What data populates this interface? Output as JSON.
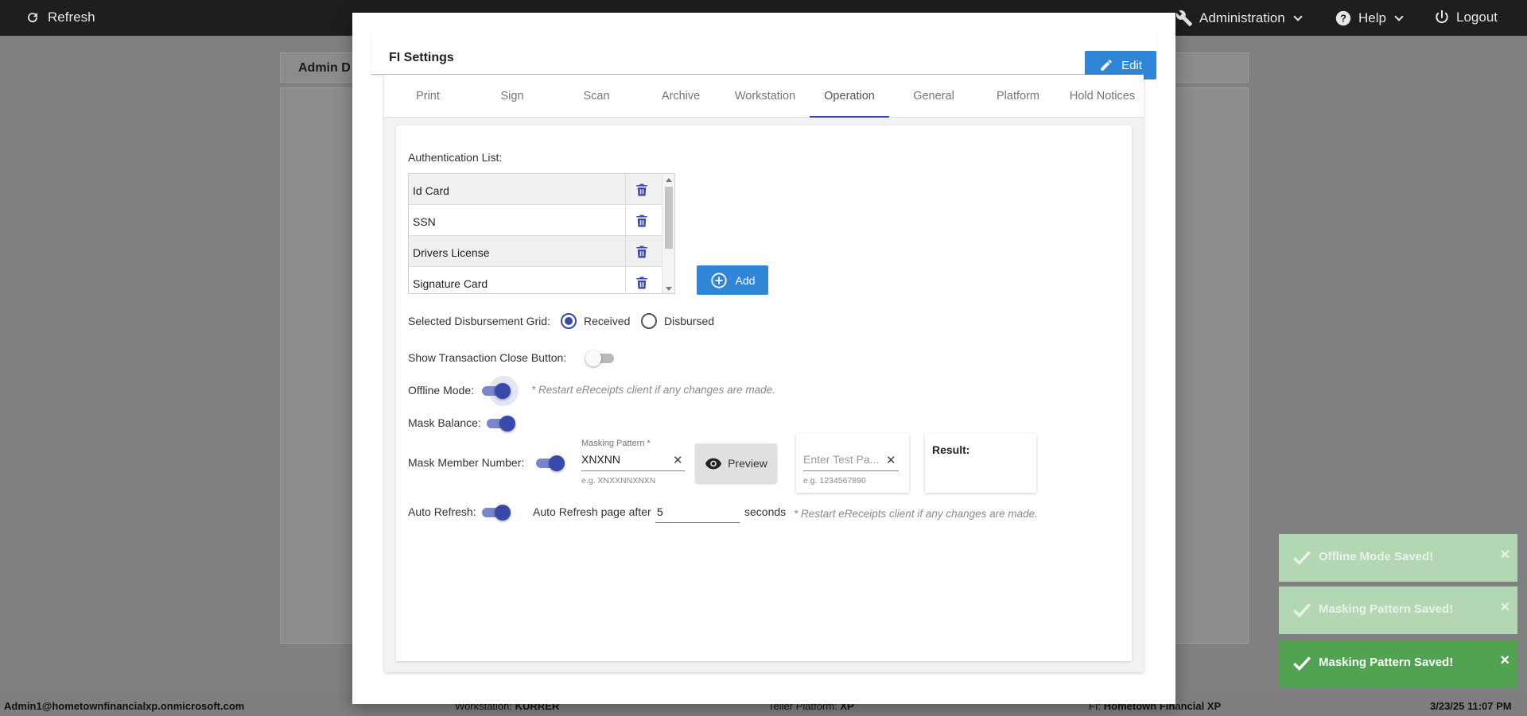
{
  "topbar": {
    "refresh_label": "Refresh",
    "administration_label": "Administration",
    "help_label": "Help",
    "logout_label": "Logout"
  },
  "background": {
    "tab_label": "Admin D"
  },
  "modal": {
    "title": "FI Settings",
    "edit_label": "Edit",
    "tabs": [
      {
        "label": "Print"
      },
      {
        "label": "Sign"
      },
      {
        "label": "Scan"
      },
      {
        "label": "Archive"
      },
      {
        "label": "Workstation"
      },
      {
        "label": "Operation"
      },
      {
        "label": "General"
      },
      {
        "label": "Platform"
      },
      {
        "label": "Hold Notices"
      }
    ],
    "active_tab": "Operation"
  },
  "operation": {
    "auth_list_label": "Authentication List:",
    "auth_items": [
      {
        "name": "Id Card"
      },
      {
        "name": "SSN"
      },
      {
        "name": "Drivers License"
      },
      {
        "name": "Signature Card"
      }
    ],
    "add_label": "Add",
    "disbursement_label": "Selected Disbursement Grid:",
    "disbursement_options": [
      {
        "label": "Received",
        "selected": true
      },
      {
        "label": "Disbursed",
        "selected": false
      }
    ],
    "show_close_label": "Show Transaction Close Button:",
    "show_close_on": false,
    "offline_label": "Offline Mode:",
    "offline_on": true,
    "offline_note": "* Restart eReceipts client if any changes are made.",
    "mask_balance_label": "Mask Balance:",
    "mask_balance_on": true,
    "mask_member_label": "Mask Member Number:",
    "mask_member_on": true,
    "masking_pattern_label": "Masking Pattern *",
    "masking_pattern_value": "XNXNN",
    "masking_pattern_hint": "e.g. XNXXNNXNXN",
    "preview_label": "Preview",
    "test_placeholder": "Enter Test Pa...",
    "test_hint": "e.g. 1234567890",
    "result_label": "Result:",
    "auto_refresh_label": "Auto Refresh:",
    "auto_refresh_on": true,
    "auto_refresh_text": "Auto Refresh page after",
    "auto_refresh_value": "5",
    "auto_refresh_unit": "seconds",
    "auto_refresh_note": "* Restart eReceipts client if any changes are made."
  },
  "toasts": [
    {
      "message": "Offline Mode Saved!",
      "faded": true
    },
    {
      "message": "Masking Pattern Saved!",
      "faded": true
    },
    {
      "message": "Masking Pattern Saved!",
      "faded": false
    }
  ],
  "statusbar": {
    "user": "Admin1@hometownfinancialxp.onmicrosoft.com",
    "workstation_label": "Workstation:",
    "workstation_value": "KURRER",
    "platform_label": "Teller Platform:",
    "platform_value": "XP",
    "fi_label": "FI:",
    "fi_value": "Hometown Financial XP",
    "datetime": "3/23/25 11:07 PM"
  },
  "colors": {
    "accent_blue": "#2f86d6",
    "indigo": "#3949ab",
    "toast_green": "#51a351",
    "topbar": "#1e1e1e"
  }
}
